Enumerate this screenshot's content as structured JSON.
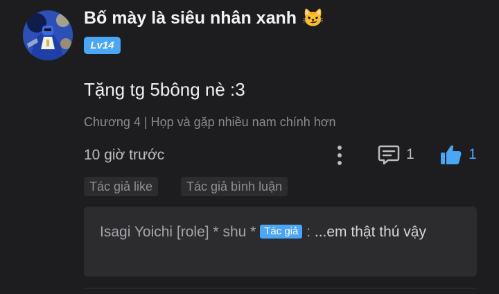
{
  "comment": {
    "username": "Bố mày là siêu nhân xanh",
    "username_emoji": "😼",
    "level": "Lv14",
    "text": "Tặng tg 5bông nè :3",
    "chapter": "Chương 4 | Họp và gặp nhiều nam chính hơn",
    "time": "10 giờ trước",
    "reply_count": "1",
    "like_count": "1",
    "tags": [
      "Tác giả like",
      "Tác giả bình luận"
    ],
    "reply": {
      "author": "Isagi Yoichi [role] * shu *",
      "badge": "Tác giả",
      "separator": " : ",
      "text": "...em thật thú vậy"
    }
  },
  "colors": {
    "background": "#1d1d1f",
    "accent": "#4aa6f6",
    "tag_bg": "#2c2c2f",
    "muted_text": "#8a8a90"
  },
  "icons": {
    "more": "more-vertical-icon",
    "reply": "comment-icon",
    "like": "thumbs-up-icon"
  }
}
